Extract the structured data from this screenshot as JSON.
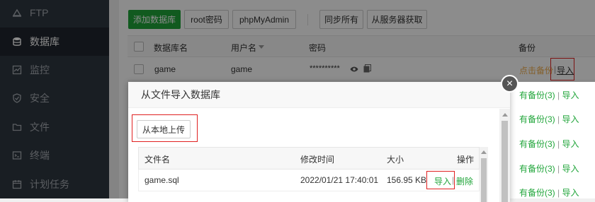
{
  "sidebar": {
    "items": [
      {
        "label": "FTP",
        "icon": "ftp-icon"
      },
      {
        "label": "数据库",
        "icon": "database-icon"
      },
      {
        "label": "监控",
        "icon": "monitor-icon"
      },
      {
        "label": "安全",
        "icon": "shield-icon"
      },
      {
        "label": "文件",
        "icon": "folder-icon"
      },
      {
        "label": "终端",
        "icon": "terminal-icon"
      },
      {
        "label": "计划任务",
        "icon": "calendar-icon"
      }
    ]
  },
  "toolbar": {
    "add_db": "添加数据库",
    "root_pwd": "root密码",
    "phpmyadmin": "phpMyAdmin",
    "sync_all": "同步所有",
    "fetch_server": "从服务器获取"
  },
  "table": {
    "headers": {
      "name": "数据库名",
      "user": "用户名",
      "password": "密码",
      "backup": "备份"
    },
    "row": {
      "name": "game",
      "user": "game",
      "password": "**********",
      "backup_action": "点击备份",
      "import": "导入"
    }
  },
  "backup_rows": [
    {
      "text": "有备份(3)",
      "sep": "|",
      "import": "导入"
    },
    {
      "text": "有备份(3)",
      "sep": "|",
      "import": "导入"
    },
    {
      "text": "有备份(3)",
      "sep": "|",
      "import": "导入"
    },
    {
      "text": "有备份(3)",
      "sep": "|",
      "import": "导入"
    },
    {
      "text": "有备份(3)",
      "sep": "|",
      "import": "导入"
    }
  ],
  "modal": {
    "title": "从文件导入数据库",
    "upload_label": "从本地上传",
    "close_symbol": "×",
    "file_table": {
      "headers": {
        "name": "文件名",
        "mtime": "修改时间",
        "size": "大小",
        "action": "操作"
      },
      "rows": [
        {
          "name": "game.sql",
          "mtime": "2022/01/21 17:40:01",
          "size": "156.95 KB",
          "import": "导入",
          "sep": "|",
          "delete": "删除"
        }
      ]
    }
  },
  "colors": {
    "green": "#20a53a",
    "sidebar_bg": "#2f3740",
    "highlight": "#e02020",
    "orange": "#f0ad4e"
  }
}
